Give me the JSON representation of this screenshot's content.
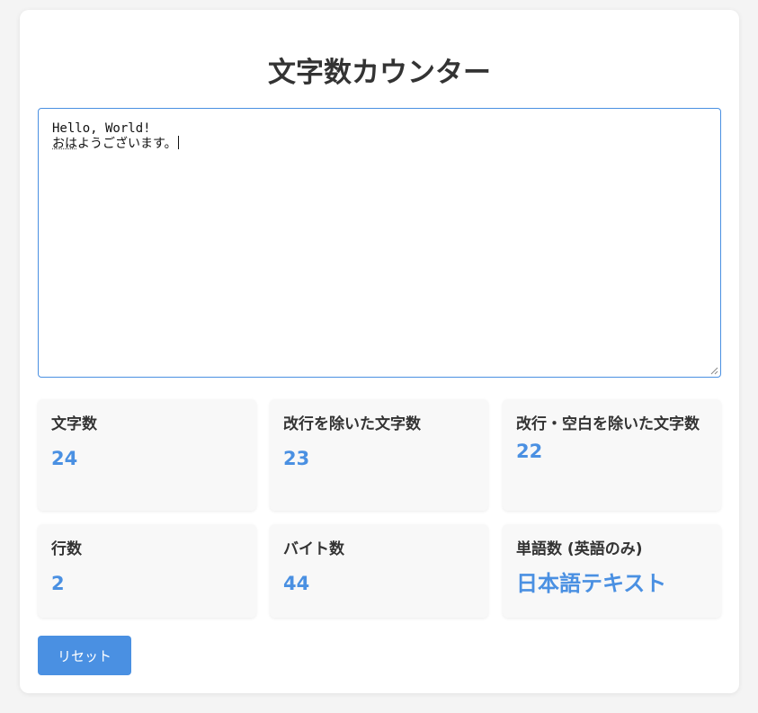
{
  "app": {
    "title": "文字数カウンター"
  },
  "editor": {
    "line1": "Hello, World!",
    "line2_composing": "おは",
    "line2_rest": "ようございます。"
  },
  "stats": [
    {
      "label": "文字数",
      "value": "24"
    },
    {
      "label": "改行を除いた文字数",
      "value": "23"
    },
    {
      "label": "改行・空白を除いた文字数",
      "value": "22"
    },
    {
      "label": "行数",
      "value": "2"
    },
    {
      "label": "バイト数",
      "value": "44"
    },
    {
      "label": "単語数 (英語のみ)",
      "value": "日本語テキスト"
    }
  ],
  "actions": {
    "reset_label": "リセット"
  },
  "colors": {
    "accent": "#4a90e2",
    "background": "#f4f4f4",
    "card": "#ffffff",
    "stat_card": "#f8f8f8",
    "text": "#333333"
  }
}
